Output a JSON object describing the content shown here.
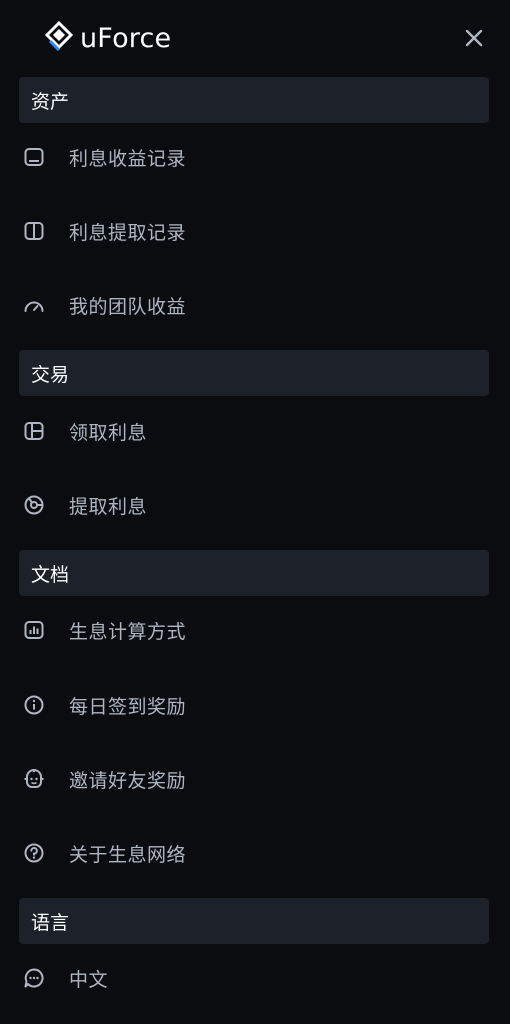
{
  "header": {
    "logo_text": "uForce",
    "close_icon": "close-icon"
  },
  "sections": [
    {
      "title": "资产",
      "items": [
        {
          "label": "利息收益记录",
          "icon": "wallet-icon"
        },
        {
          "label": "利息提取记录",
          "icon": "panel-icon"
        },
        {
          "label": "我的团队收益",
          "icon": "gauge-icon"
        }
      ]
    },
    {
      "title": "交易",
      "items": [
        {
          "label": "领取利息",
          "icon": "layout-icon"
        },
        {
          "label": "提取利息",
          "icon": "pie-chart-icon"
        }
      ]
    },
    {
      "title": "文档",
      "items": [
        {
          "label": "生息计算方式",
          "icon": "bar-chart-icon"
        },
        {
          "label": "每日签到奖励",
          "icon": "info-icon"
        },
        {
          "label": "邀请好友奖励",
          "icon": "robot-icon"
        },
        {
          "label": "关于生息网络",
          "icon": "help-icon"
        }
      ]
    },
    {
      "title": "语言",
      "items": [
        {
          "label": "中文",
          "icon": "chat-icon"
        }
      ]
    }
  ],
  "colors": {
    "background": "#0a0c10",
    "section_bg": "#1c212a",
    "text": "#aeb6c4",
    "title": "#ffffff"
  }
}
